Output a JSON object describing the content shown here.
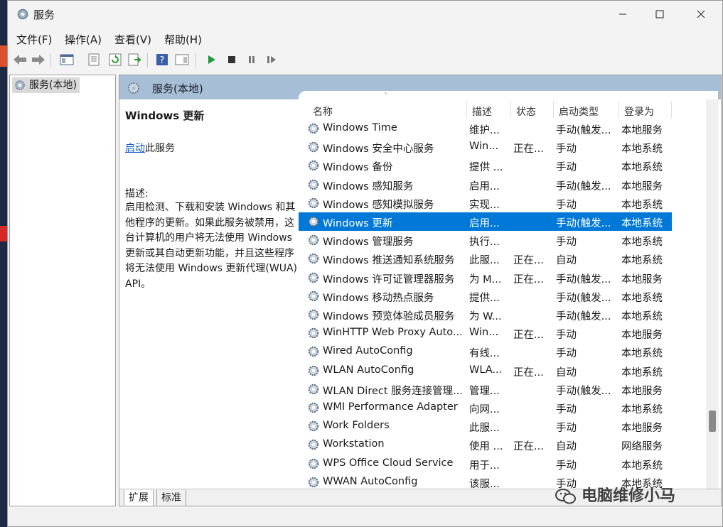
{
  "window": {
    "title": "服务"
  },
  "menu": [
    "文件(F)",
    "操作(A)",
    "查看(V)",
    "帮助(H)"
  ],
  "tree": {
    "root_label": "服务(本地)"
  },
  "pane_header": "服务(本地)",
  "details": {
    "title": "Windows 更新",
    "start_link": "启动",
    "start_suffix": "此服务",
    "desc_label": "描述:",
    "description": "启用检测、下载和安装 Windows 和其他程序的更新。如果此服务被禁用，这台计算机的用户将无法使用 Windows 更新或其自动更新功能，并且这些程序将无法使用 Windows 更新代理(WUA) API。"
  },
  "columns": [
    "名称",
    "描述",
    "状态",
    "启动类型",
    "登录为"
  ],
  "services": [
    {
      "name": "Windows Time",
      "desc": "维护...",
      "status": "",
      "startup": "手动(触发...",
      "logon": "本地服务"
    },
    {
      "name": "Windows 安全中心服务",
      "desc": "Win...",
      "status": "正在...",
      "startup": "手动",
      "logon": "本地系统"
    },
    {
      "name": "Windows 备份",
      "desc": "提供 ...",
      "status": "",
      "startup": "手动",
      "logon": "本地系统"
    },
    {
      "name": "Windows 感知服务",
      "desc": "启用...",
      "status": "",
      "startup": "手动(触发...",
      "logon": "本地服务"
    },
    {
      "name": "Windows 感知模拟服务",
      "desc": "实现...",
      "status": "",
      "startup": "手动",
      "logon": "本地系统"
    },
    {
      "name": "Windows 更新",
      "desc": "启用...",
      "status": "",
      "startup": "手动(触发...",
      "logon": "本地系统",
      "selected": true
    },
    {
      "name": "Windows 管理服务",
      "desc": "执行...",
      "status": "",
      "startup": "手动",
      "logon": "本地系统"
    },
    {
      "name": "Windows 推送通知系统服务",
      "desc": "此服...",
      "status": "正在...",
      "startup": "自动",
      "logon": "本地系统"
    },
    {
      "name": "Windows 许可证管理器服务",
      "desc": "为 M...",
      "status": "正在...",
      "startup": "手动(触发...",
      "logon": "本地服务"
    },
    {
      "name": "Windows 移动热点服务",
      "desc": "提供...",
      "status": "",
      "startup": "手动(触发...",
      "logon": "本地系统"
    },
    {
      "name": "Windows 预览体验成员服务",
      "desc": "为 W...",
      "status": "",
      "startup": "手动(触发...",
      "logon": "本地系统"
    },
    {
      "name": "WinHTTP Web Proxy Auto...",
      "desc": "Win...",
      "status": "正在...",
      "startup": "手动",
      "logon": "本地服务"
    },
    {
      "name": "Wired AutoConfig",
      "desc": "有线...",
      "status": "",
      "startup": "手动",
      "logon": "本地系统"
    },
    {
      "name": "WLAN AutoConfig",
      "desc": "WLA...",
      "status": "正在...",
      "startup": "自动",
      "logon": "本地系统"
    },
    {
      "name": "WLAN Direct 服务连接管理...",
      "desc": "管理...",
      "status": "",
      "startup": "手动(触发...",
      "logon": "本地服务"
    },
    {
      "name": "WMI Performance Adapter",
      "desc": "向网...",
      "status": "",
      "startup": "手动",
      "logon": "本地系统"
    },
    {
      "name": "Work Folders",
      "desc": "此服...",
      "status": "",
      "startup": "手动",
      "logon": "本地服务"
    },
    {
      "name": "Workstation",
      "desc": "使用 ...",
      "status": "正在...",
      "startup": "自动",
      "logon": "网络服务"
    },
    {
      "name": "WPS Office Cloud Service",
      "desc": "用于...",
      "status": "",
      "startup": "手动",
      "logon": "本地系统"
    },
    {
      "name": "WWAN AutoConfig",
      "desc": "该服...",
      "status": "",
      "startup": "手动",
      "logon": "本地系统"
    }
  ],
  "tabs": [
    "扩展",
    "标准"
  ],
  "watermark": "电脑维修小马",
  "colors": {
    "selection": "#0078d7",
    "header": "#a6bfd7",
    "link": "#0b57c7"
  }
}
